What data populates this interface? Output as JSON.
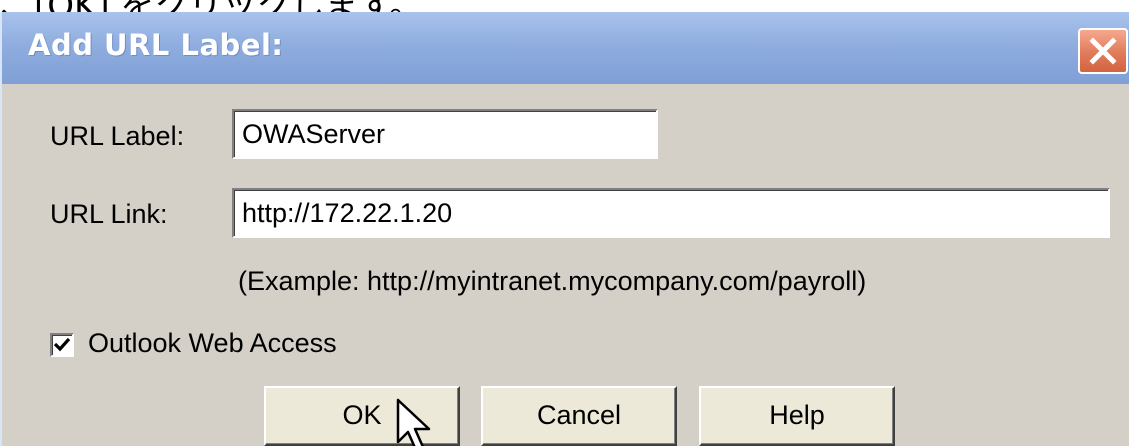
{
  "caption_fragment": "、[OK] をクリックします。",
  "dialog": {
    "title": "Add URL Label:",
    "close_label": "close"
  },
  "form": {
    "url_label": {
      "label": "URL Label:",
      "value": "OWAServer"
    },
    "url_link": {
      "label": "URL Link:",
      "value": "http://172.22.1.20"
    },
    "example_text": "(Example: http://myintranet.mycompany.com/payroll)",
    "outlook_web_access": {
      "label": "Outlook Web Access",
      "checked": true
    }
  },
  "buttons": {
    "ok": "OK",
    "cancel": "Cancel",
    "help": "Help"
  },
  "colors": {
    "titlebar": "#8fadde",
    "dialog_bg": "#d4d0c8",
    "close_btn": "#e07b5a"
  },
  "icons": {
    "close": "close-x-icon",
    "check": "checkmark-icon",
    "cursor": "mouse-pointer-icon"
  }
}
